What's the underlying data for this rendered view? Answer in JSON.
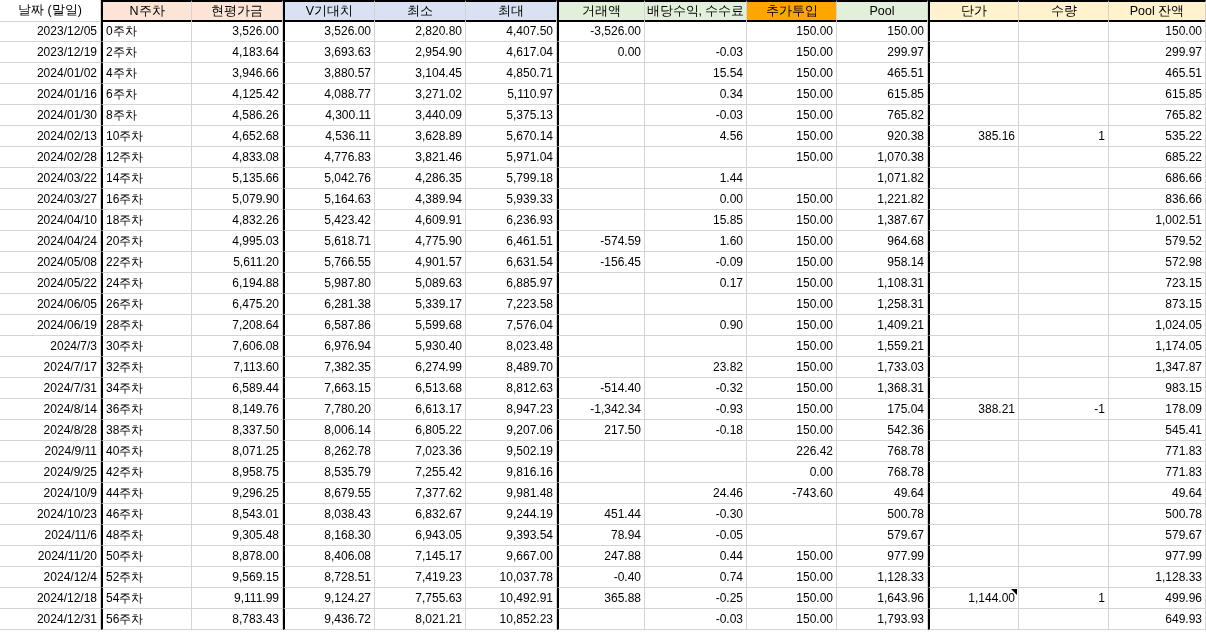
{
  "columns": [
    {
      "label": "날짜 (말일)",
      "color": "#ffffff"
    },
    {
      "label": "N주차",
      "color": "#fce4d6"
    },
    {
      "label": "현평가금",
      "color": "#fce4d6"
    },
    {
      "label": "V기대치",
      "color": "#d9e1f2"
    },
    {
      "label": "최소",
      "color": "#d9e1f2"
    },
    {
      "label": "최대",
      "color": "#d9e1f2"
    },
    {
      "label": "거래액",
      "color": "#e2efda"
    },
    {
      "label": "배당수익, 수수료",
      "color": "#e2efda"
    },
    {
      "label": "추가투입",
      "color": "#ffa500"
    },
    {
      "label": "Pool",
      "color": "#e2efda"
    },
    {
      "label": "단가",
      "color": "#fff2cc"
    },
    {
      "label": "수량",
      "color": "#fff2cc"
    },
    {
      "label": "Pool 잔액",
      "color": "#fff2cc"
    }
  ],
  "rows": [
    {
      "cells": [
        "2023/12/05",
        "0주차",
        "3,526.00",
        "3,526.00",
        "2,820.80",
        "4,407.50",
        "-3,526.00",
        "",
        "150.00",
        "150.00",
        "",
        "",
        "150.00"
      ],
      "comment_on_price": false
    },
    {
      "cells": [
        "2023/12/19",
        "2주차",
        "4,183.64",
        "3,693.63",
        "2,954.90",
        "4,617.04",
        "0.00",
        "-0.03",
        "150.00",
        "299.97",
        "",
        "",
        "299.97"
      ],
      "comment_on_price": false
    },
    {
      "cells": [
        "2024/01/02",
        "4주차",
        "3,946.66",
        "3,880.57",
        "3,104.45",
        "4,850.71",
        "",
        "15.54",
        "150.00",
        "465.51",
        "",
        "",
        "465.51"
      ],
      "comment_on_price": false
    },
    {
      "cells": [
        "2024/01/16",
        "6주차",
        "4,125.42",
        "4,088.77",
        "3,271.02",
        "5,110.97",
        "",
        "0.34",
        "150.00",
        "615.85",
        "",
        "",
        "615.85"
      ],
      "comment_on_price": false
    },
    {
      "cells": [
        "2024/01/30",
        "8주차",
        "4,586.26",
        "4,300.11",
        "3,440.09",
        "5,375.13",
        "",
        "-0.03",
        "150.00",
        "765.82",
        "",
        "",
        "765.82"
      ],
      "comment_on_price": false
    },
    {
      "cells": [
        "2024/02/13",
        "10주차",
        "4,652.68",
        "4,536.11",
        "3,628.89",
        "5,670.14",
        "",
        "4.56",
        "150.00",
        "920.38",
        "385.16",
        "1",
        "535.22"
      ],
      "comment_on_price": false
    },
    {
      "cells": [
        "2024/02/28",
        "12주차",
        "4,833.08",
        "4,776.83",
        "3,821.46",
        "5,971.04",
        "",
        "",
        "150.00",
        "1,070.38",
        "",
        "",
        "685.22"
      ],
      "comment_on_price": false
    },
    {
      "cells": [
        "2024/03/22",
        "14주차",
        "5,135.66",
        "5,042.76",
        "4,286.35",
        "5,799.18",
        "",
        "1.44",
        "",
        "1,071.82",
        "",
        "",
        "686.66"
      ],
      "comment_on_price": false
    },
    {
      "cells": [
        "2024/03/27",
        "16주차",
        "5,079.90",
        "5,164.63",
        "4,389.94",
        "5,939.33",
        "",
        "0.00",
        "150.00",
        "1,221.82",
        "",
        "",
        "836.66"
      ],
      "comment_on_price": false
    },
    {
      "cells": [
        "2024/04/10",
        "18주차",
        "4,832.26",
        "5,423.42",
        "4,609.91",
        "6,236.93",
        "",
        "15.85",
        "150.00",
        "1,387.67",
        "",
        "",
        "1,002.51"
      ],
      "comment_on_price": false
    },
    {
      "cells": [
        "2024/04/24",
        "20주차",
        "4,995.03",
        "5,618.71",
        "4,775.90",
        "6,461.51",
        "-574.59",
        "1.60",
        "150.00",
        "964.68",
        "",
        "",
        "579.52"
      ],
      "comment_on_price": false
    },
    {
      "cells": [
        "2024/05/08",
        "22주차",
        "5,611.20",
        "5,766.55",
        "4,901.57",
        "6,631.54",
        "-156.45",
        "-0.09",
        "150.00",
        "958.14",
        "",
        "",
        "572.98"
      ],
      "comment_on_price": false
    },
    {
      "cells": [
        "2024/05/22",
        "24주차",
        "6,194.88",
        "5,987.80",
        "5,089.63",
        "6,885.97",
        "",
        "0.17",
        "150.00",
        "1,108.31",
        "",
        "",
        "723.15"
      ],
      "comment_on_price": false
    },
    {
      "cells": [
        "2024/06/05",
        "26주차",
        "6,475.20",
        "6,281.38",
        "5,339.17",
        "7,223.58",
        "",
        "",
        "150.00",
        "1,258.31",
        "",
        "",
        "873.15"
      ],
      "comment_on_price": false
    },
    {
      "cells": [
        "2024/06/19",
        "28주차",
        "7,208.64",
        "6,587.86",
        "5,599.68",
        "7,576.04",
        "",
        "0.90",
        "150.00",
        "1,409.21",
        "",
        "",
        "1,024.05"
      ],
      "comment_on_price": false
    },
    {
      "cells": [
        "2024/7/3",
        "30주차",
        "7,606.08",
        "6,976.94",
        "5,930.40",
        "8,023.48",
        "",
        "",
        "150.00",
        "1,559.21",
        "",
        "",
        "1,174.05"
      ],
      "comment_on_price": false
    },
    {
      "cells": [
        "2024/7/17",
        "32주차",
        "7,113.60",
        "7,382.35",
        "6,274.99",
        "8,489.70",
        "",
        "23.82",
        "150.00",
        "1,733.03",
        "",
        "",
        "1,347.87"
      ],
      "comment_on_price": false
    },
    {
      "cells": [
        "2024/7/31",
        "34주차",
        "6,589.44",
        "7,663.15",
        "6,513.68",
        "8,812.63",
        "-514.40",
        "-0.32",
        "150.00",
        "1,368.31",
        "",
        "",
        "983.15"
      ],
      "comment_on_price": false
    },
    {
      "cells": [
        "2024/8/14",
        "36주차",
        "8,149.76",
        "7,780.20",
        "6,613.17",
        "8,947.23",
        "-1,342.34",
        "-0.93",
        "150.00",
        "175.04",
        "388.21",
        "-1",
        "178.09"
      ],
      "comment_on_price": false
    },
    {
      "cells": [
        "2024/8/28",
        "38주차",
        "8,337.50",
        "8,006.14",
        "6,805.22",
        "9,207.06",
        "217.50",
        "-0.18",
        "150.00",
        "542.36",
        "",
        "",
        "545.41"
      ],
      "comment_on_price": false
    },
    {
      "cells": [
        "2024/9/11",
        "40주차",
        "8,071.25",
        "8,262.78",
        "7,023.36",
        "9,502.19",
        "",
        "",
        "226.42",
        "768.78",
        "",
        "",
        "771.83"
      ],
      "comment_on_price": false
    },
    {
      "cells": [
        "2024/9/25",
        "42주차",
        "8,958.75",
        "8,535.79",
        "7,255.42",
        "9,816.16",
        "",
        "",
        "0.00",
        "768.78",
        "",
        "",
        "771.83"
      ],
      "comment_on_price": false
    },
    {
      "cells": [
        "2024/10/9",
        "44주차",
        "9,296.25",
        "8,679.55",
        "7,377.62",
        "9,981.48",
        "",
        "24.46",
        "-743.60",
        "49.64",
        "",
        "",
        "49.64"
      ],
      "comment_on_price": false
    },
    {
      "cells": [
        "2024/10/23",
        "46주차",
        "8,543.01",
        "8,038.43",
        "6,832.67",
        "9,244.19",
        "451.44",
        "-0.30",
        "",
        "500.78",
        "",
        "",
        "500.78"
      ],
      "comment_on_price": false
    },
    {
      "cells": [
        "2024/11/6",
        "48주차",
        "9,305.48",
        "8,168.30",
        "6,943.05",
        "9,393.54",
        "78.94",
        "-0.05",
        "",
        "579.67",
        "",
        "",
        "579.67"
      ],
      "comment_on_price": false
    },
    {
      "cells": [
        "2024/11/20",
        "50주차",
        "8,878.00",
        "8,406.08",
        "7,145.17",
        "9,667.00",
        "247.88",
        "0.44",
        "150.00",
        "977.99",
        "",
        "",
        "977.99"
      ],
      "comment_on_price": false
    },
    {
      "cells": [
        "2024/12/4",
        "52주차",
        "9,569.15",
        "8,728.51",
        "7,419.23",
        "10,037.78",
        "-0.40",
        "0.74",
        "150.00",
        "1,128.33",
        "",
        "",
        "1,128.33"
      ],
      "comment_on_price": false
    },
    {
      "cells": [
        "2024/12/18",
        "54주차",
        "9,111.99",
        "9,124.27",
        "7,755.63",
        "10,492.91",
        "365.88",
        "-0.25",
        "150.00",
        "1,643.96",
        "1,144.00",
        "1",
        "499.96"
      ],
      "comment_on_price": true
    },
    {
      "cells": [
        "2024/12/31",
        "56주차",
        "8,783.43",
        "9,436.72",
        "8,021.21",
        "10,852.23",
        "",
        "-0.03",
        "150.00",
        "1,793.93",
        "",
        "",
        "649.93"
      ],
      "comment_on_price": false
    }
  ]
}
